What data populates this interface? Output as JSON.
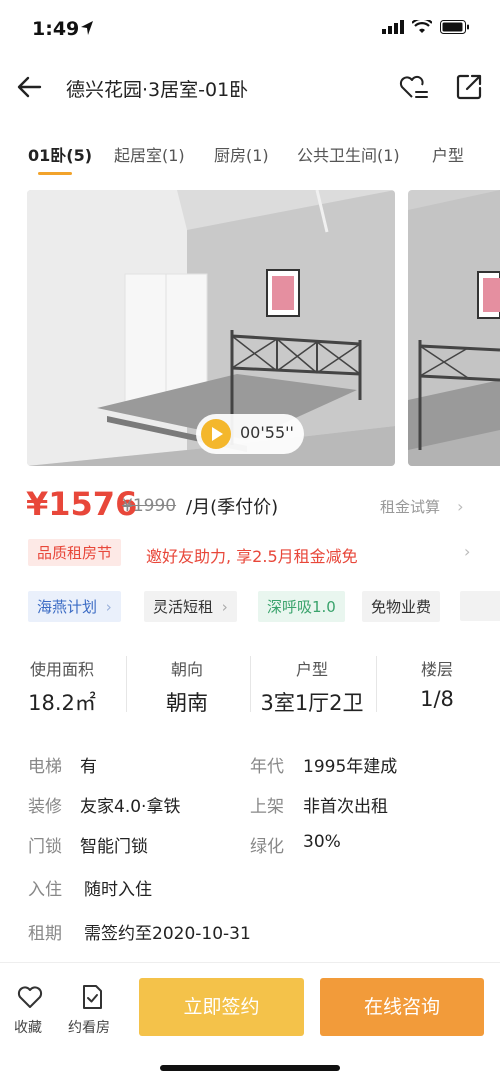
{
  "status": {
    "time": "1:49"
  },
  "header": {
    "title": "德兴花园·3居室-01卧"
  },
  "tabs": [
    {
      "label": "01卧(5)",
      "active": true
    },
    {
      "label": "起居室(1)"
    },
    {
      "label": "厨房(1)"
    },
    {
      "label": "公共卫生间(1)"
    },
    {
      "label": "户型"
    }
  ],
  "video": {
    "duration": "00'55''"
  },
  "price": {
    "current": "¥1576",
    "original": "¥1990",
    "unit": "/月(季付价)",
    "calc_label": "租金试算"
  },
  "promo": {
    "tag": "品质租房节",
    "text": "邀好友助力, 享2.5月租金减免"
  },
  "tags": [
    {
      "label": "海燕计划",
      "style": "blue",
      "arrow": true
    },
    {
      "label": "灵活短租",
      "style": "gray",
      "arrow": true
    },
    {
      "label": "深呼吸1.0",
      "style": "green",
      "arrow": false
    },
    {
      "label": "免物业费",
      "style": "gray",
      "arrow": false
    }
  ],
  "specs": [
    {
      "label": "使用面积",
      "value": "18.2㎡"
    },
    {
      "label": "朝向",
      "value": "朝南"
    },
    {
      "label": "户型",
      "value": "3室1厅2卫"
    },
    {
      "label": "楼层",
      "value": "1/8"
    }
  ],
  "info": {
    "elevator": {
      "key": "电梯",
      "value": "有"
    },
    "year": {
      "key": "年代",
      "value": "1995年建成"
    },
    "decor": {
      "key": "装修",
      "value": "友家4.0·拿铁"
    },
    "listing": {
      "key": "上架",
      "value": "非首次出租"
    },
    "lock": {
      "key": "门锁",
      "value": "智能门锁"
    },
    "green": {
      "key": "绿化",
      "value": "30%"
    },
    "checkin": {
      "key": "入住",
      "value": "随时入住"
    },
    "lease": {
      "key": "租期",
      "value": "需签约至2020-10-31"
    }
  },
  "bottom": {
    "favorite": "收藏",
    "appointment": "约看房",
    "sign": "立即签约",
    "consult": "在线咨询"
  },
  "colors": {
    "accent_red": "#e8473a",
    "accent_yellow": "#f4c24a",
    "accent_orange": "#f29b3a"
  }
}
